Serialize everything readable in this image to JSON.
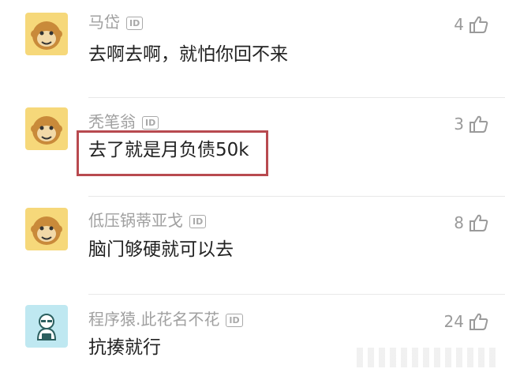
{
  "comments": [
    {
      "username": "马岱",
      "id_badge": "ID",
      "text": "去啊去啊，就怕你回不来",
      "likes": "4",
      "avatar_icon": "monkey-avatar-icon"
    },
    {
      "username": "秃笔翁",
      "id_badge": "ID",
      "text": "去了就是月负债50k",
      "likes": "3",
      "avatar_icon": "monkey-avatar-icon"
    },
    {
      "username": "低压锅蒂亚戈",
      "id_badge": "ID",
      "text": "脑门够硬就可以去",
      "likes": "8",
      "avatar_icon": "monkey-avatar-icon"
    },
    {
      "username": "程序猿.此花名不花",
      "id_badge": "ID",
      "text": "抗揍就行",
      "likes": "24",
      "avatar_icon": "coder-avatar-icon"
    }
  ],
  "like_icon": "thumbs-up-icon",
  "highlight_color": "#b84a4f"
}
